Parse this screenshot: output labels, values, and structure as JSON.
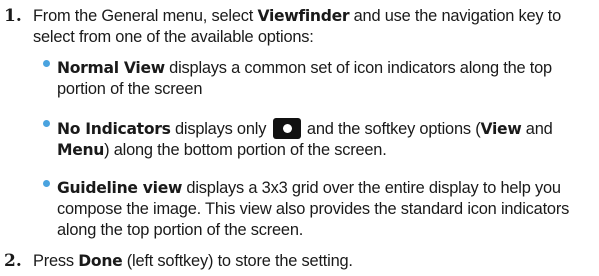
{
  "steps": [
    {
      "number": "1.",
      "text_a": "From the General menu, select ",
      "bold_a": "Viewfinder",
      "text_b": " and use the navigation key to select from one of the available options:"
    },
    {
      "number": "2.",
      "text_a": "Press ",
      "bold_a": "Done",
      "text_b": " (left softkey) to store the setting."
    }
  ],
  "bullets": [
    {
      "bold": "Normal View",
      "text": " displays a common set of icon indicators along the top portion of the screen"
    },
    {
      "bold": "No Indicators",
      "text_a": " displays only ",
      "icon": "camera-shutter-icon",
      "text_b": " and the softkey options (",
      "bold_b": "View",
      "text_c": " and ",
      "bold_c": "Menu",
      "text_d": ") along the bottom portion of the screen."
    },
    {
      "bold": "Guideline view",
      "text": " displays a 3x3 grid over the entire display to help you compose the image. This view also provides the standard icon indicators along the top portion of the screen."
    }
  ],
  "colors": {
    "bullet": "#4aa3df",
    "text": "#1a1a1a",
    "icon_bg": "#111111"
  }
}
